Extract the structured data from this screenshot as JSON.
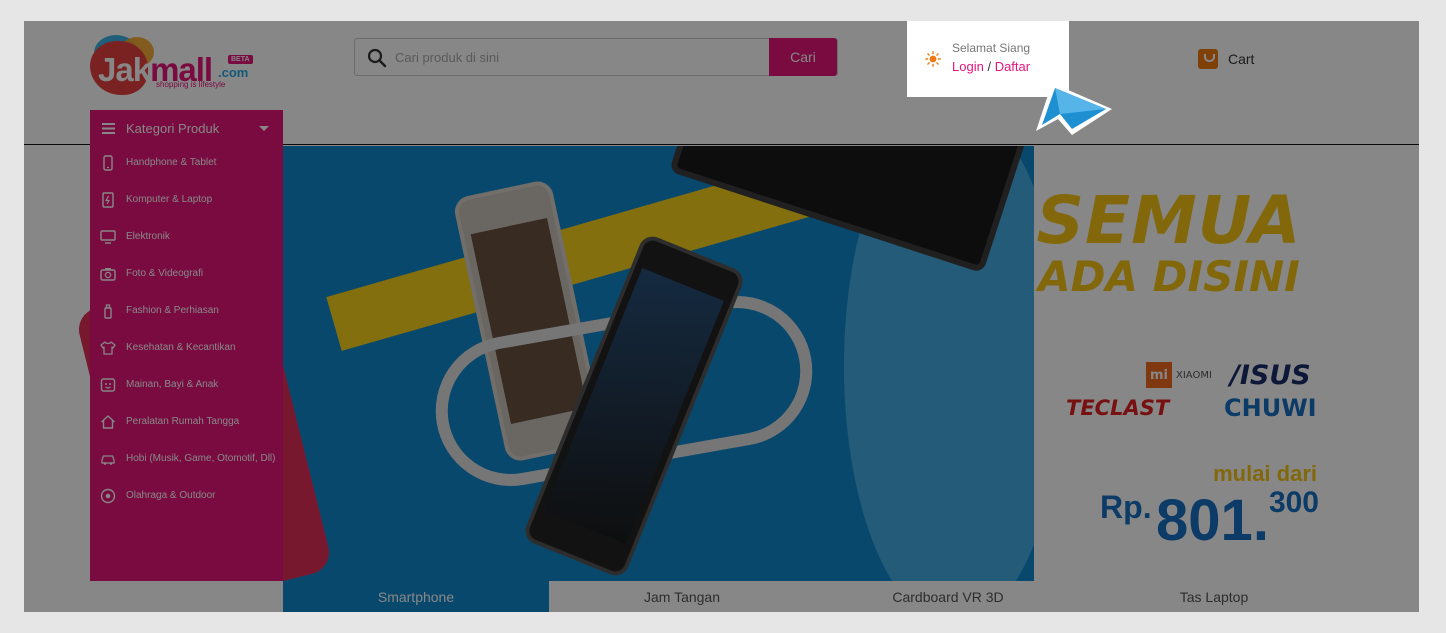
{
  "header": {
    "logo": {
      "brand_jak": "Jak",
      "brand_mall": "mall",
      "domain": ".com",
      "badge": "BETA",
      "tagline": "shopping is lifestyle"
    },
    "search": {
      "placeholder": "Cari produk di sini",
      "button_label": "Cari",
      "icon": "search-icon"
    },
    "greeting": {
      "label": "Selamat Siang",
      "login": "Login",
      "separator": "/",
      "register": "Daftar",
      "icon": "sun-icon"
    },
    "cart": {
      "label": "Cart",
      "icon": "cart-icon"
    }
  },
  "categories": {
    "title": "Kategori Produk",
    "items": [
      {
        "label": "Handphone & Tablet",
        "icon": "smartphone-icon"
      },
      {
        "label": "Komputer & Laptop",
        "icon": "computer-icon"
      },
      {
        "label": "Elektronik",
        "icon": "monitor-icon"
      },
      {
        "label": "Foto & Videografi",
        "icon": "camera-icon"
      },
      {
        "label": "Fashion & Perhiasan",
        "icon": "fashion-icon"
      },
      {
        "label": "Kesehatan & Kecantikan",
        "icon": "shirt-icon"
      },
      {
        "label": "Mainan, Bayi & Anak",
        "icon": "toy-icon"
      },
      {
        "label": "Peralatan Rumah Tangga",
        "icon": "home-icon"
      },
      {
        "label": "Hobi (Musik, Game, Otomotif, Dll)",
        "icon": "car-icon"
      },
      {
        "label": "Olahraga & Outdoor",
        "icon": "ball-icon"
      }
    ]
  },
  "banner": {
    "headline": "SEMUA",
    "subheadline": "ADA DISINI",
    "brands": {
      "xiaomi_mark": "mi",
      "xiaomi": "XIAOMI",
      "asus": "/ISUS",
      "teclast": "TECLAST",
      "chuwi": "CHUWI"
    },
    "price_prefix": "mulai dari",
    "price_currency": "Rp.",
    "price_main": "801.",
    "price_decimal": "300"
  },
  "tabs": [
    {
      "label": "Smartphone",
      "active": true
    },
    {
      "label": "Jam Tangan",
      "active": false
    },
    {
      "label": "Cardboard VR 3D",
      "active": false
    },
    {
      "label": "Tas Laptop",
      "active": false
    }
  ],
  "colors": {
    "brand_pink": "#e6157b",
    "banner_blue": "#1289ce",
    "accent_yellow": "#f5c515",
    "overlay": "rgba(0,0,0,0.47)"
  }
}
